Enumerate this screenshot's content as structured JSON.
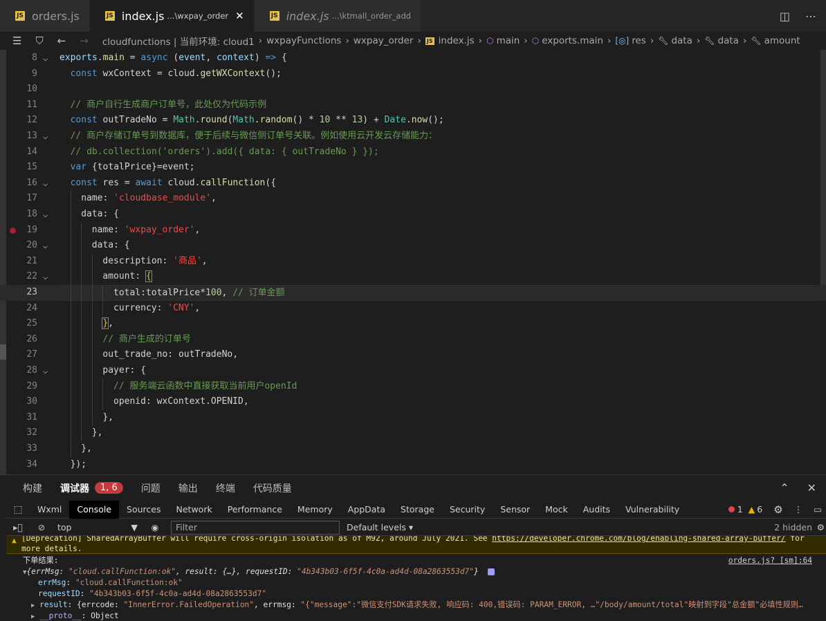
{
  "tabs": [
    {
      "name": "orders.js",
      "desc": "",
      "active": false,
      "italic": false
    },
    {
      "name": "index.js",
      "desc": "...\\wxpay_order",
      "active": true,
      "italic": false
    },
    {
      "name": "index.js",
      "desc": "...\\ktmall_order_add",
      "active": false,
      "italic": true
    }
  ],
  "breadcrumb": {
    "items": [
      "cloudfunctions | 当前环境: cloud1",
      "wxpayFunctions",
      "wxpay_order",
      "index.js",
      "main",
      "exports.main",
      "res",
      "data",
      "data",
      "amount"
    ]
  },
  "editor": {
    "current_line": 23,
    "lines": [
      {
        "n": 8,
        "fold": true,
        "bp": false,
        "indent": 0,
        "html": "<span class='v'>exports</span><span class='o'>.</span><span class='f'>main</span><span class='o'> = </span><span class='k'>async</span><span class='o'> (</span><span class='v'>event</span><span class='o'>, </span><span class='v'>context</span><span class='o'>) </span><span class='k'>=&gt;</span><span class='o'> {</span>"
      },
      {
        "n": 9,
        "fold": false,
        "bp": false,
        "indent": 1,
        "html": "<span class='k'>const</span><span class='vl'> wxContext = cloud.</span><span class='f'>getWXContext</span><span class='o'>();</span>"
      },
      {
        "n": 10,
        "fold": false,
        "bp": false,
        "indent": 1,
        "html": ""
      },
      {
        "n": 11,
        "fold": false,
        "bp": false,
        "indent": 1,
        "html": "<span class='c'>// 商户自行生成商户订单号，此处仅为代码示例</span>"
      },
      {
        "n": 12,
        "fold": false,
        "bp": false,
        "indent": 1,
        "html": "<span class='k'>const</span><span class='vl'> outTradeNo = </span><span class='t'>Math</span><span class='o'>.</span><span class='f'>round</span><span class='o'>(</span><span class='t'>Math</span><span class='o'>.</span><span class='f'>random</span><span class='o'>() * </span><span class='n'>10</span><span class='o'> ** </span><span class='n'>13</span><span class='o'>) + </span><span class='t'>Date</span><span class='o'>.</span><span class='f'>now</span><span class='o'>();</span>"
      },
      {
        "n": 13,
        "fold": true,
        "bp": false,
        "indent": 1,
        "html": "<span class='c'>// 商户存储订单号到数据库，便于后续与微信侧订单号关联。例如使用云开发云存储能力：</span>"
      },
      {
        "n": 14,
        "fold": false,
        "bp": false,
        "indent": 1,
        "html": "<span class='c'>// db.collection('orders').add({ data: { outTradeNo } });</span>"
      },
      {
        "n": 15,
        "fold": false,
        "bp": false,
        "indent": 1,
        "html": "<span class='k'>var</span><span class='vl'> {totalPrice}=event;</span>"
      },
      {
        "n": 16,
        "fold": true,
        "bp": false,
        "indent": 1,
        "html": "<span class='k'>const</span><span class='vl'> res = </span><span class='k'>await</span><span class='vl'> cloud.</span><span class='f'>callFunction</span><span class='o'>({</span>"
      },
      {
        "n": 17,
        "fold": false,
        "bp": false,
        "indent": 2,
        "html": "<span class='vl'>name: </span><span class='s2'>'cloudbase_module'</span><span class='o'>,</span>"
      },
      {
        "n": 18,
        "fold": true,
        "bp": false,
        "indent": 2,
        "html": "<span class='vl'>data: {</span>"
      },
      {
        "n": 19,
        "fold": false,
        "bp": true,
        "indent": 3,
        "html": "<span class='vl'>name: </span><span class='s2'>'wxpay_order'</span><span class='o'>,</span>"
      },
      {
        "n": 20,
        "fold": true,
        "bp": false,
        "indent": 3,
        "html": "<span class='vl'>data: {</span>"
      },
      {
        "n": 21,
        "fold": false,
        "bp": false,
        "indent": 4,
        "html": "<span class='vl'>description: </span><span class='s2'>'商品'</span><span class='o'>,</span>"
      },
      {
        "n": 22,
        "fold": true,
        "bp": false,
        "indent": 4,
        "html": "<span class='vl'>amount: </span><span class='p bracket-hl'>{</span>"
      },
      {
        "n": 23,
        "fold": false,
        "bp": false,
        "indent": 5,
        "html": "<span class='vl'>total:totalPrice*</span><span class='n'>100</span><span class='o'>, </span><span class='c'>// 订单金额</span>"
      },
      {
        "n": 24,
        "fold": false,
        "bp": false,
        "indent": 5,
        "html": "<span class='vl'>currency: </span><span class='s2'>'CNY'</span><span class='o'>,</span>"
      },
      {
        "n": 25,
        "fold": false,
        "bp": false,
        "indent": 4,
        "html": "<span class='p bracket-hl'>}</span><span class='o'>,</span>"
      },
      {
        "n": 26,
        "fold": false,
        "bp": false,
        "indent": 4,
        "html": "<span class='c'>// 商户生成的订单号</span>"
      },
      {
        "n": 27,
        "fold": false,
        "bp": false,
        "indent": 4,
        "html": "<span class='vl'>out_trade_no: outTradeNo,</span>"
      },
      {
        "n": 28,
        "fold": true,
        "bp": false,
        "indent": 4,
        "html": "<span class='vl'>payer: {</span>"
      },
      {
        "n": 29,
        "fold": false,
        "bp": false,
        "indent": 5,
        "html": "<span class='c'>// 服务端云函数中直接获取当前用户openId</span>"
      },
      {
        "n": 30,
        "fold": false,
        "bp": false,
        "indent": 5,
        "html": "<span class='vl'>openid: wxContext.OPENID,</span>"
      },
      {
        "n": 31,
        "fold": false,
        "bp": false,
        "indent": 4,
        "html": "<span class='vl'>},</span>"
      },
      {
        "n": 32,
        "fold": false,
        "bp": false,
        "indent": 3,
        "html": "<span class='vl'>},</span>"
      },
      {
        "n": 33,
        "fold": false,
        "bp": false,
        "indent": 2,
        "html": "<span class='vl'>},</span>"
      },
      {
        "n": 34,
        "fold": false,
        "bp": false,
        "indent": 1,
        "html": "<span class='o'>});</span>"
      }
    ]
  },
  "panel": {
    "tabs": [
      "构建",
      "调试器",
      "问题",
      "输出",
      "终端",
      "代码质量"
    ],
    "active": "调试器",
    "badge": "1, 6"
  },
  "devtools": {
    "tabs": [
      "Wxml",
      "Console",
      "Sources",
      "Network",
      "Performance",
      "Memory",
      "AppData",
      "Storage",
      "Security",
      "Sensor",
      "Mock",
      "Audits",
      "Vulnerability"
    ],
    "active": "Console",
    "errors": "1",
    "warnings": "6"
  },
  "console_toolbar": {
    "context": "top",
    "filter_placeholder": "Filter",
    "levels": "Default levels ▾",
    "hidden": "2 hidden"
  },
  "console": {
    "warning_line1": "[Deprecation] SharedArrayBuffer will require cross-origin isolation as of M92, around July 2021. See ",
    "warning_link": "https://developer.chrome.com/blog/enabling-shared-array-buffer/",
    "warning_tail": " for",
    "warning_line2": "more details.",
    "log_label": "下单结果:",
    "source": "orders.js? [sm]:64",
    "obj_summary_pre": "{errMsg: ",
    "obj_summary_errmsg": "\"cloud.callFunction:ok\"",
    "obj_summary_mid": ", result: {…}, requestID: ",
    "obj_summary_reqid": "\"4b343b03-6f5f-4c0a-ad4d-08a2863553d7\"",
    "obj_summary_end": "}",
    "errMsg_key": "errMsg",
    "errMsg_val": "\"cloud.callFunction:ok\"",
    "requestID_key": "requestID",
    "requestID_val": "\"4b343b03-6f5f-4c0a-ad4d-08a2863553d7\"",
    "result_key": "result",
    "result_val_pre": "{errcode: ",
    "result_errcode": "\"InnerError.FailedOperation\"",
    "result_mid": ", errmsg: ",
    "result_errmsg": "\"{\"message\":\"微信支付SDK请求失败, 响应码: 400,错误码: PARAM_ERROR, …\"/body/amount/total\"映射到字段\"总金额\"必填性规则…",
    "proto_key": "__proto__",
    "proto_val": "Object"
  }
}
